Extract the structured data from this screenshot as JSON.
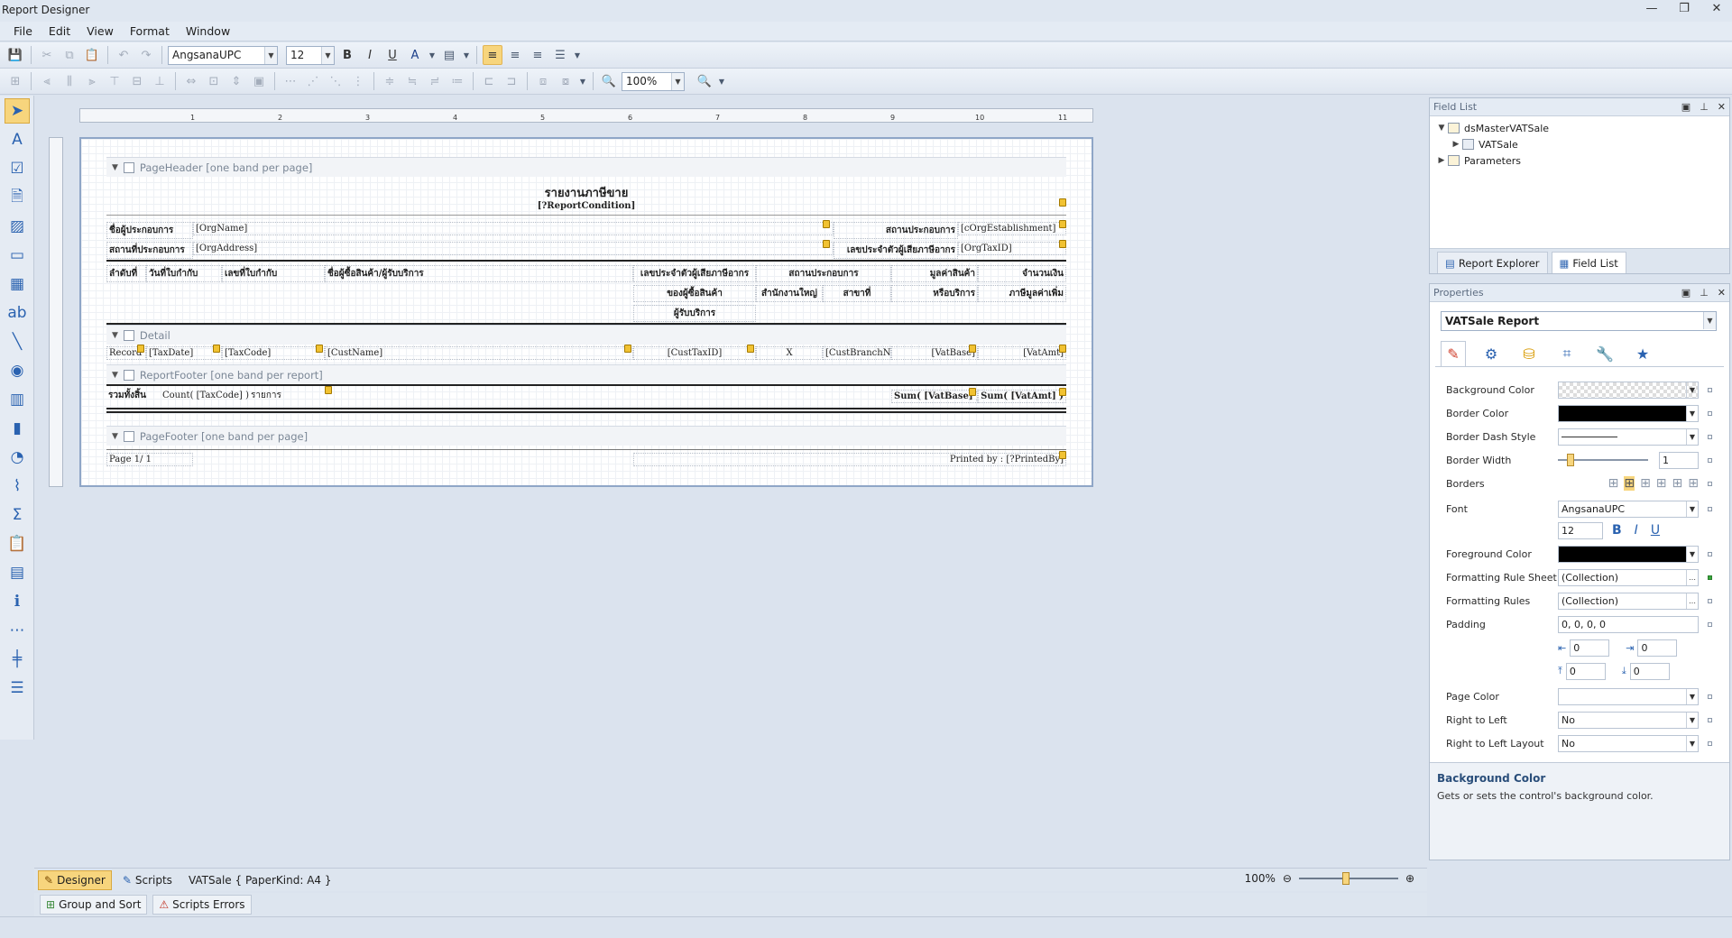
{
  "window": {
    "title": "Report Designer",
    "controls": [
      "—",
      "❐",
      "✕"
    ]
  },
  "menu": [
    "File",
    "Edit",
    "View",
    "Format",
    "Window"
  ],
  "toolbar": {
    "font_name": "AngsanaUPC",
    "font_size": "12",
    "zoom": "100%",
    "bold": "B",
    "italic": "I",
    "underline": "U"
  },
  "ruler": {
    "ticks": [
      "1",
      "2",
      "3",
      "4",
      "5",
      "6",
      "7",
      "8",
      "9",
      "10",
      "11"
    ]
  },
  "report": {
    "bands": {
      "page_header": "PageHeader [one band per page]",
      "detail": "Detail",
      "report_footer": "ReportFooter [one band per report]",
      "page_footer": "PageFooter [one band per page]"
    },
    "title": "รายงานภาษีขาย",
    "condition": "[?ReportCondition]",
    "org_name_label": "ชื่อผู้ประกอบการ",
    "org_name": "[OrgName]",
    "establishment_label": "สถานประกอบการ",
    "establishment": "[cOrgEstablishment]",
    "org_address_label": "สถานที่ประกอบการ",
    "org_address": "[OrgAddress]",
    "taxid_label": "เลขประจำตัวผู้เสียภาษีอากร",
    "org_taxid": "[OrgTaxID]",
    "columns": {
      "seq": "ลำดับที่",
      "date": "วันที่ใบกำกับ",
      "taxcode": "เลขที่ใบกำกับ",
      "custname": "ชื่อผู้ซื้อสินค้า/ผู้รับบริการ",
      "custtax_1": "เลขประจำตัวผู้เสียภาษีอากร",
      "custtax_2": "ของผู้ซื้อสินค้า",
      "custtax_3": "ผู้รับบริการ",
      "branch": "สถานประกอบการ",
      "head_office": "สำนักงานใหญ่",
      "branch_no": "สาขาที่",
      "value_1": "มูลค่าสินค้า",
      "value_2": "หรือบริการ",
      "amount_1": "จำนวนเงิน",
      "amount_2": "ภาษีมูลค่าเพิ่ม"
    },
    "detail": {
      "record": "Record",
      "taxdate": "[TaxDate]",
      "taxcode": "[TaxCode]",
      "custname": "[CustName]",
      "custtaxid": "[CustTaxID]",
      "x": "X",
      "branchno": "[CustBranchNo]",
      "vatbase": "[VatBase]",
      "vatamt": "[VatAmt]"
    },
    "footer": {
      "total_label": "รวมทั้งสิ้น",
      "count": "Count( [TaxCode] )",
      "items": "รายการ",
      "sum_base": "Sum( [VatBase] )",
      "sum_amt": "Sum( [VatAmt] )"
    },
    "page_footer": {
      "page": "Page 1/ 1",
      "printed": "Printed by : [?PrintedBy]"
    }
  },
  "bottom_tabs": {
    "designer": "Designer",
    "scripts": "Scripts",
    "info": "VATSale { PaperKind: A4 }",
    "zoom": "100%"
  },
  "bottom_tabs2": {
    "group_sort": "Group and Sort",
    "script_errors": "Scripts Errors"
  },
  "field_list": {
    "title": "Field List",
    "items": [
      "dsMasterVATSale",
      "VATSale",
      "Parameters"
    ],
    "tabs": [
      "Report Explorer",
      "Field List"
    ]
  },
  "properties": {
    "title": "Properties",
    "object": "VATSale  Report",
    "rows": {
      "background_color": "Background Color",
      "border_color": "Border Color",
      "border_dash_style": "Border Dash Style",
      "border_width": "Border Width",
      "border_width_value": "1",
      "borders": "Borders",
      "font": "Font",
      "font_value": "AngsanaUPC",
      "font_size": "12",
      "foreground_color": "Foreground Color",
      "formatting_rule_sheet": "Formatting Rule Sheet",
      "formatting_rule_sheet_value": "(Collection)",
      "formatting_rules": "Formatting Rules",
      "formatting_rules_value": "(Collection)",
      "padding": "Padding",
      "padding_value": "0, 0, 0, 0",
      "pad_left": "0",
      "pad_right": "0",
      "pad_top": "0",
      "pad_bottom": "0",
      "page_color": "Page Color",
      "right_to_left": "Right to Left",
      "right_to_left_value": "No",
      "rtl_layout": "Right to Left Layout",
      "rtl_layout_value": "No"
    },
    "desc_title": "Background Color",
    "desc_text": "Gets or sets the control's background color."
  }
}
